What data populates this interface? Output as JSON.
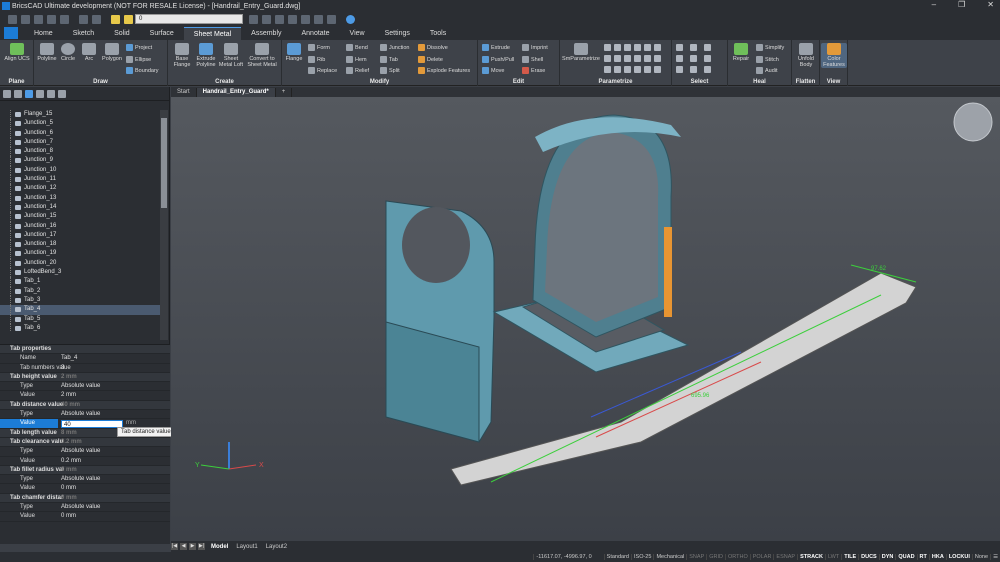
{
  "app": {
    "title": "BricsCAD Ultimate development (NOT FOR RESALE License) - [Handrail_Entry_Guard.dwg]"
  },
  "qat": {
    "layer_value": "0"
  },
  "ribbon": {
    "tabs": [
      "Home",
      "Sketch",
      "Solid",
      "Surface",
      "Sheet Metal",
      "Assembly",
      "Annotate",
      "View",
      "Settings",
      "Tools"
    ],
    "panels": {
      "plane": {
        "label": "Plane",
        "align": "Align UCS"
      },
      "draw": {
        "label": "Draw",
        "polyline": "Polyline",
        "circle": "Circle",
        "arc": "Arc",
        "polygon": "Polygon",
        "project": "Project",
        "ellipse": "Ellipse",
        "boundary": "Boundary"
      },
      "create": {
        "label": "Create",
        "base_flange": "Base Flange",
        "extrude_polyline": "Extrude Polyline",
        "sheet_metal_loft": "Sheet Metal Loft",
        "convert": "Convert to Sheet Metal"
      },
      "modify": {
        "label": "Modify",
        "flange": "Flange",
        "form": "Form",
        "rib": "Rib",
        "replace": "Replace",
        "bend": "Bend",
        "hem": "Hem",
        "relief": "Relief",
        "junction": "Junction",
        "tab": "Tab",
        "split": "Split",
        "dissolve": "Dissolve",
        "delete": "Delete",
        "explode": "Explode Features"
      },
      "edit": {
        "label": "Edit",
        "extrude": "Extrude",
        "pushpull": "Push/Pull",
        "move": "Move",
        "imprint": "Imprint",
        "shell": "Shell",
        "erase": "Erase"
      },
      "parametrize": {
        "label": "Parametrize",
        "smparam": "SmParametrize"
      },
      "select": {
        "label": "Select"
      },
      "heal": {
        "label": "Heal",
        "repair": "Repair",
        "simplify": "Simplify",
        "stitch": "Stitch",
        "audit": "Audit"
      },
      "flatten": {
        "label": "Flatten",
        "unfold": "Unfold Body"
      },
      "view": {
        "label": "View",
        "color_features": "Color Features"
      }
    }
  },
  "tree": {
    "items": [
      "Flange_15",
      "Junction_5",
      "Junction_6",
      "Junction_7",
      "Junction_8",
      "Junction_9",
      "Junction_10",
      "Junction_11",
      "Junction_12",
      "Junction_13",
      "Junction_14",
      "Junction_15",
      "Junction_16",
      "Junction_17",
      "Junction_18",
      "Junction_19",
      "Junction_20",
      "LoftedBend_3",
      "Tab_1",
      "Tab_2",
      "Tab_3",
      "Tab_4",
      "Tab_5",
      "Tab_6"
    ],
    "selected_index": 21
  },
  "props": {
    "header": "Tab properties",
    "name_k": "Name",
    "name_v": "Tab_4",
    "tabnum_k": "Tab numbers value",
    "tabnum_v": "3",
    "height_k": "Tab height value",
    "height_v": "2 mm",
    "type_k": "Type",
    "abs": "Absolute value",
    "value_k": "Value",
    "height_val": "2 mm",
    "dist_k": "Tab distance value",
    "dist_v": "40 mm",
    "dist_edit": "40",
    "dist_unit": "mm",
    "length_k": "Tab length value",
    "length_v": "8 mm",
    "clear_k": "Tab clearance valu",
    "clear_v": "0.2 mm",
    "clear_val": "0.2 mm",
    "fillet_k": "Tab fillet radius val",
    "fillet_v": "0 mm",
    "fillet_val": "0 mm",
    "chamfer_k": "Tab chamfer distar",
    "chamfer_v": "0 mm",
    "chamfer_val": "0 mm",
    "tooltip": "Tab distance value"
  },
  "doctabs": {
    "start": "Start",
    "file": "Handrail_Entry_Guard*"
  },
  "layouts": {
    "model": "Model",
    "l1": "Layout1",
    "l2": "Layout2"
  },
  "dims": {
    "d1": "97.62",
    "d2": "695.96"
  },
  "status": {
    "coords": "-11617.07, -4996.97, 0",
    "items": [
      "Standard",
      "ISO-25",
      "Mechanical",
      "SNAP",
      "GRID",
      "ORTHO",
      "POLAR",
      "ESNAP",
      "STRACK",
      "LWT",
      "TILE",
      "DUCS",
      "DYN",
      "QUAD",
      "RT",
      "HKA",
      "LOCKUI",
      "None"
    ]
  }
}
